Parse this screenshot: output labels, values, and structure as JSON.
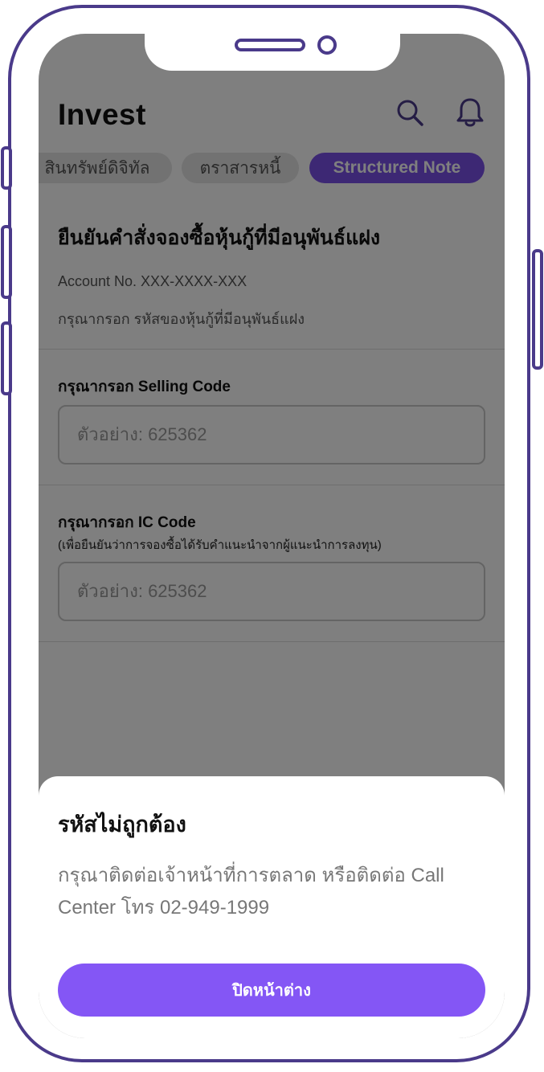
{
  "app": {
    "title": "Invest"
  },
  "header": {
    "search_icon": "search-icon",
    "bell_icon": "bell-icon",
    "accent_color": "#4a3a8a"
  },
  "tabs": [
    {
      "label": "สินทรัพย์ดิจิทัล",
      "active": false
    },
    {
      "label": "ตราสารหนี้",
      "active": false
    },
    {
      "label": "Structured Note",
      "active": true
    }
  ],
  "form": {
    "title": "ยืนยันคำสั่งจองซื้อหุ้นกู้ที่มีอนุพันธ์แฝง",
    "account": "Account No. XXX-XXXX-XXX",
    "hint": "กรุณากรอก รหัสของหุ้นกู้ที่มีอนุพันธ์แฝง",
    "selling_code": {
      "label": "กรุณากรอก Selling Code",
      "placeholder": "ตัวอย่าง: 625362",
      "value": ""
    },
    "ic_code": {
      "label": "กรุณากรอก IC Code",
      "sublabel": "(เพื่อยืนยันว่าการจองซื้อได้รับคำแนะนำจากผู้แนะนำการลงทุน)",
      "placeholder": "ตัวอย่าง: 625362",
      "value": ""
    }
  },
  "sheet": {
    "title": "รหัสไม่ถูกต้อง",
    "message": "กรุณาติดต่อเจ้าหน้าที่การตลาด หรือติดต่อ Call Center โทร 02-949-1999",
    "button_label": "ปิดหน้าต่าง",
    "button_color": "#8456f5"
  }
}
